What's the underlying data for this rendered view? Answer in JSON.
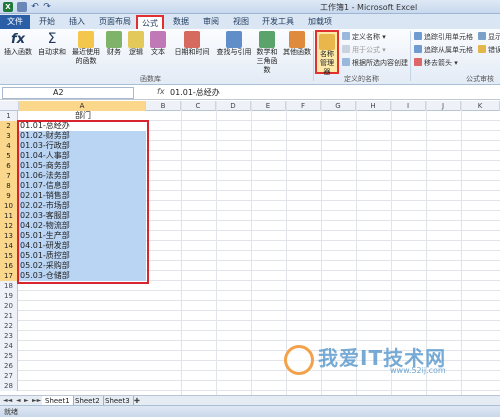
{
  "window": {
    "title": "工作簿1 - Microsoft Excel"
  },
  "tabs": [
    "文件",
    "开始",
    "插入",
    "页面布局",
    "公式",
    "数据",
    "审阅",
    "视图",
    "开发工具",
    "加载项"
  ],
  "ribbon": {
    "function_library": {
      "buttons": [
        "插入函数",
        "自动求和",
        "最近使用的函数",
        "财务",
        "逻辑",
        "文本",
        "日期和时间",
        "查找与引用",
        "数学和三角函数",
        "其他函数"
      ],
      "group_label": "函数库"
    },
    "defined_names": {
      "name_manager": "名称管理器",
      "define_name": "定义名称",
      "use_in_formula": "用于公式",
      "create_from_selection": "根据所选内容创建",
      "group_label": "定义的名称"
    },
    "formula_auditing": {
      "trace_precedents": "追踪引用单元格",
      "trace_dependents": "追踪从属单元格",
      "remove_arrows": "移去箭头",
      "show_formulas_partial": "显示",
      "error_check_partial": "错误",
      "group_label": "公式审核"
    }
  },
  "formula_bar": {
    "name_box": "A2",
    "fx": "fx",
    "value": "01.01-总经办"
  },
  "columns": [
    "A",
    "B",
    "C",
    "D",
    "E",
    "F",
    "G",
    "H",
    "I",
    "J",
    "K"
  ],
  "rows": [
    {
      "num": "1",
      "a": "部门"
    },
    {
      "num": "2",
      "a": "01.01-总经办"
    },
    {
      "num": "3",
      "a": "01.02-财务部"
    },
    {
      "num": "4",
      "a": "01.03-行政部"
    },
    {
      "num": "5",
      "a": "01.04-人事部"
    },
    {
      "num": "6",
      "a": "01.05-商务部"
    },
    {
      "num": "7",
      "a": "01.06-法务部"
    },
    {
      "num": "8",
      "a": "01.07-信息部"
    },
    {
      "num": "9",
      "a": "02.01-销售部"
    },
    {
      "num": "10",
      "a": "02.02-市场部"
    },
    {
      "num": "11",
      "a": "02.03-客服部"
    },
    {
      "num": "12",
      "a": "04.02-物流部"
    },
    {
      "num": "13",
      "a": "05.01-生产部"
    },
    {
      "num": "14",
      "a": "04.01-研发部"
    },
    {
      "num": "15",
      "a": "05.01-质控部"
    },
    {
      "num": "16",
      "a": "05.02-采购部"
    },
    {
      "num": "17",
      "a": "05.03-仓储部"
    },
    {
      "num": "18",
      "a": ""
    },
    {
      "num": "19",
      "a": ""
    },
    {
      "num": "20",
      "a": ""
    },
    {
      "num": "21",
      "a": ""
    },
    {
      "num": "22",
      "a": ""
    },
    {
      "num": "23",
      "a": ""
    },
    {
      "num": "24",
      "a": ""
    },
    {
      "num": "25",
      "a": ""
    },
    {
      "num": "26",
      "a": ""
    },
    {
      "num": "27",
      "a": ""
    },
    {
      "num": "28",
      "a": ""
    }
  ],
  "sheets": [
    "Sheet1",
    "Sheet2",
    "Sheet3"
  ],
  "status": "就绪",
  "watermark": {
    "text": "我爱IT技术网",
    "url": "www.52ij.com"
  },
  "colors": {
    "selection_border": "#d8242c",
    "selection_fill": "#bad4f3",
    "header_highlight": "#fbd78b"
  }
}
